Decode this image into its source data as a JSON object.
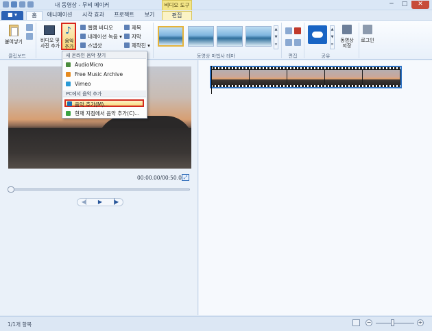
{
  "window": {
    "title": "내 동영상 - 무비 메이커",
    "context_tab_header": "비디오 도구",
    "minimize": "─",
    "maximize": "□",
    "close": "✕"
  },
  "tabs": {
    "file": "■ ▾",
    "items": [
      "홈",
      "애니메이션",
      "시각 효과",
      "프로젝트",
      "보기",
      "편집"
    ]
  },
  "ribbon": {
    "clipboard": {
      "paste": "붙여넣기",
      "group": "클립보드"
    },
    "add": {
      "add_video": "비디오 및\n사진 추가",
      "add_music": "음악\n추가",
      "webcam": "웹캠 비디오",
      "narration": "내레이션 녹음",
      "snapshot": "스냅샷",
      "title": "제목",
      "caption": "자막",
      "credits": "제작진"
    },
    "themes": {
      "group": "동영상 마법사 테마"
    },
    "editing": {
      "group": "편집"
    },
    "share": {
      "group": "공유",
      "save_movie": "동영상\n저장",
      "sign_in": "로그인"
    }
  },
  "music_menu": {
    "online_header": "새 온라인 음악 찾기",
    "online_items": [
      "AudioMicro",
      "Free Music Archive",
      "Vimeo"
    ],
    "pc_header": "PC에서 음악 추가",
    "pc_items": [
      "음악 추가(M)...",
      "현재 지점에서 음악 추가(C)..."
    ]
  },
  "preview": {
    "timecode": "00:00.00/00:50.00"
  },
  "status": {
    "items_text": "1/1개 항목"
  },
  "colors": {
    "accent": "#2b62b5",
    "highlight_border": "#d9261c",
    "context_tab": "#f3e587"
  }
}
